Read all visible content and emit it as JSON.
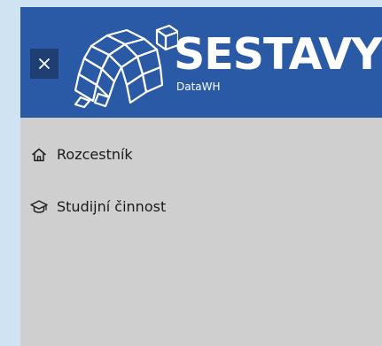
{
  "header": {
    "close_label": "×",
    "brand_title": "SESTAVY",
    "brand_subtitle": "DataWH",
    "colors": {
      "header_bg": "#2a5aa6",
      "close_bg": "#1f3f73",
      "content_bg": "#cfcfcf",
      "page_bg": "#cfe3f3"
    }
  },
  "menu": {
    "items": [
      {
        "label": "Rozcestník",
        "icon": "home-icon"
      },
      {
        "label": "Studijní činnost",
        "icon": "graduation-cap-icon"
      }
    ]
  }
}
